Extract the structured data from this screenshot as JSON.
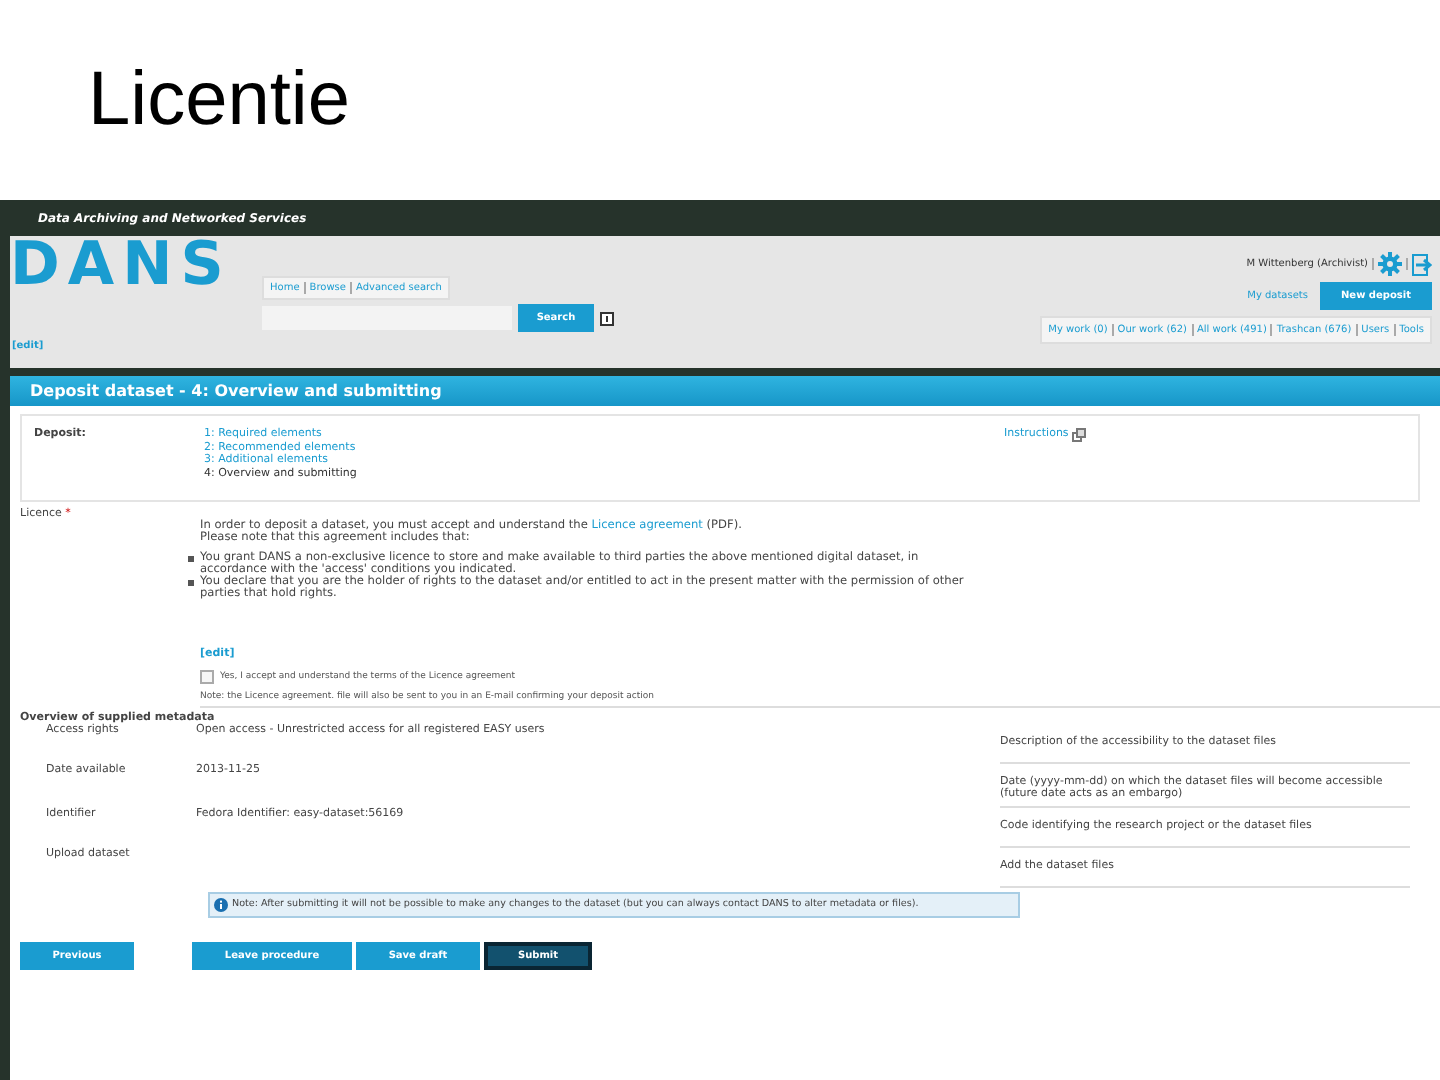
{
  "slide": {
    "title": "Licentie"
  },
  "header": {
    "tagline": "Data Archiving and Networked Services",
    "logo": "DANS"
  },
  "nav_links": [
    "Home",
    "Browse",
    "Advanced search"
  ],
  "search": {
    "button": "Search"
  },
  "user": {
    "name": "M Wittenberg (Archivist)",
    "my_datasets": "My datasets",
    "new_deposit": "New deposit"
  },
  "edit_link": "[edit]",
  "tabs": [
    {
      "label": "My work (0)",
      "selected": false
    },
    {
      "label": "Our work (62)",
      "selected": false
    },
    {
      "label": "All work (491)",
      "selected": false
    },
    {
      "label": "Trashcan (676)",
      "selected": false
    },
    {
      "label": "Users",
      "selected": false
    },
    {
      "label": "Tools",
      "selected": false
    }
  ],
  "page_title": "Deposit dataset - 4: Overview and submitting",
  "deposit": {
    "label": "Deposit:",
    "steps": [
      {
        "label": "1: Required elements",
        "selected": false
      },
      {
        "label": "2: Recommended elements",
        "selected": false
      },
      {
        "label": "3: Additional elements",
        "selected": false
      },
      {
        "label": "4: Overview and submitting",
        "selected": true
      }
    ],
    "instructions": "Instructions"
  },
  "licence": {
    "label": "Licence",
    "required_mark": "*",
    "intro_before": "In order to deposit a dataset, you must accept and understand the",
    "intro_link": "Licence agreement",
    "intro_after": "(PDF).",
    "note": "Please note that this agreement includes that:",
    "bullets": [
      "You grant DANS a non-exclusive licence to store and make available to third parties the above mentioned digital dataset, in accordance with the 'access' conditions you indicated.",
      "You declare that you are the holder of rights to the dataset and/or entitled to act in the present matter with the permission of other parties that hold rights."
    ],
    "edit_link": "[edit]",
    "checkbox": {
      "label": "Yes, I accept and understand the terms of the Licence agreement",
      "checked": false
    },
    "footnote": "Note: the Licence agreement. file will also be sent to you in an E-mail confirming your deposit action"
  },
  "overview": {
    "title": "Overview of supplied metadata",
    "rows": [
      {
        "label": "Access rights",
        "value": "Open access - Unrestricted access for all registered EASY users",
        "description": "Description of the accessibility to the dataset files"
      },
      {
        "label": "Date available",
        "value": "2013-11-25",
        "description": "Date (yyyy-mm-dd) on which the dataset files will become accessible (future date acts as an embargo)"
      },
      {
        "label": "Identifier",
        "value": "Fedora Identifier: easy-dataset:56169",
        "description": "Code identifying the research project or the dataset files"
      },
      {
        "label": "Upload dataset",
        "value": "",
        "description": "Add the dataset files"
      }
    ]
  },
  "notice": "Note: After submitting it will not be possible to make any changes to the dataset (but you can always contact DANS to alter metadata or files).",
  "buttons": [
    {
      "label": "Previous",
      "kind": "previous"
    },
    {
      "label": "Leave procedure",
      "kind": "leave"
    },
    {
      "label": "Save draft",
      "kind": "save"
    },
    {
      "label": "Submit",
      "kind": "submit"
    }
  ]
}
